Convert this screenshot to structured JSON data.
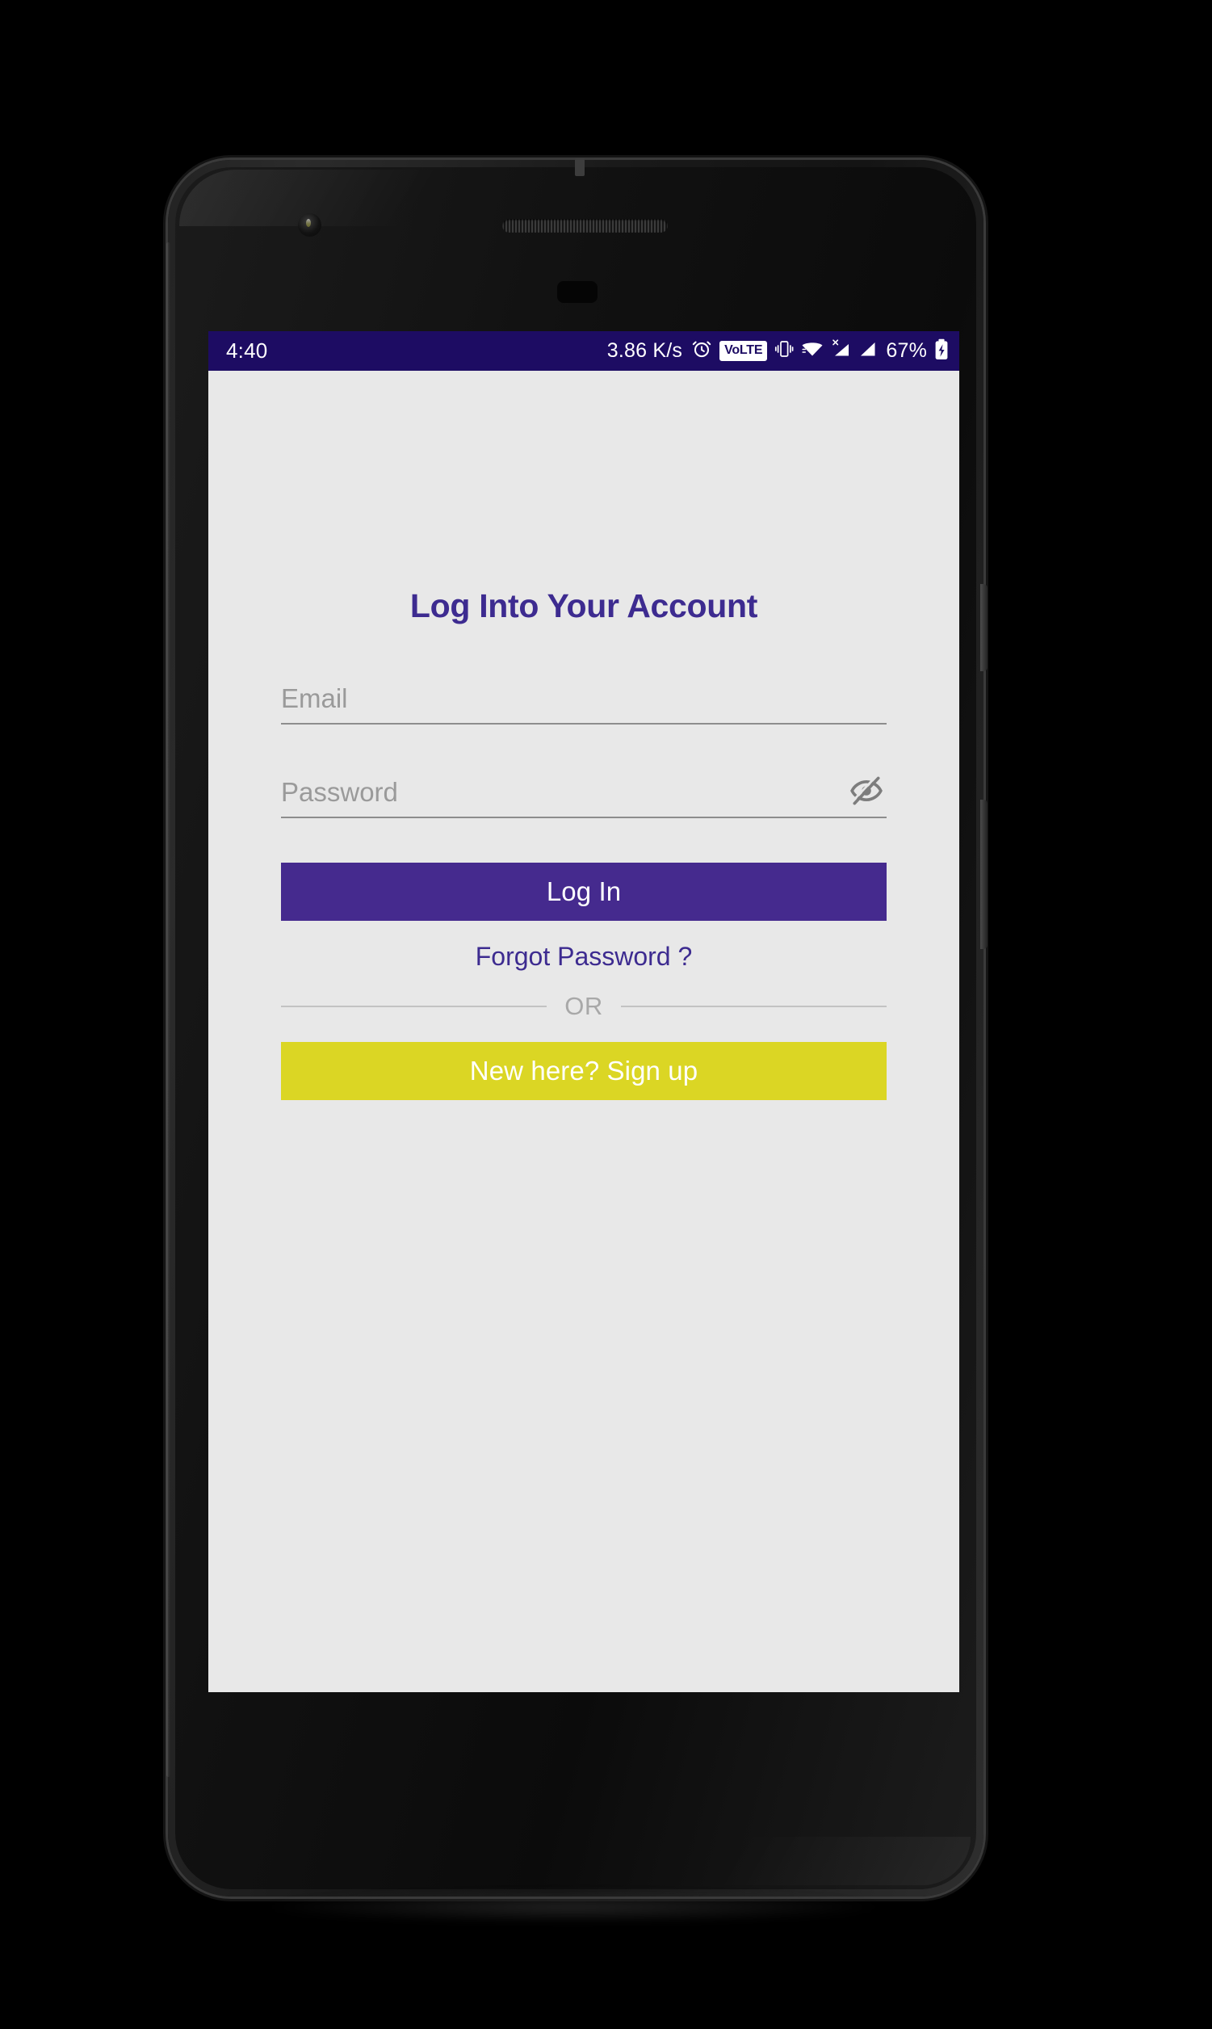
{
  "device": {
    "frame_color": "#1a1a1a",
    "screen_bg": "#e8e8e8",
    "camera_icon": "front-camera-icon",
    "earpiece_icon": "earpiece-speaker-icon",
    "sensor_icon": "proximity-sensor-icon",
    "power_button_label": "Power",
    "volume_button_label": "Volume"
  },
  "status_bar": {
    "background": "#1d0c63",
    "foreground": "#ffffff",
    "clock": "4:40",
    "network_speed": "3.86 K/s",
    "battery_percent": "67%",
    "icons": [
      "alarm-clock-icon",
      "volte-icon",
      "vibrate-icon",
      "wifi-icon",
      "mobile-signal-x-icon",
      "mobile-signal-icon",
      "battery-charging-icon"
    ],
    "volte_label": "VoLTE"
  },
  "screen": {
    "title": "Log Into Your Account",
    "title_color": "#3d2b90",
    "email": {
      "placeholder": "Email",
      "value": ""
    },
    "password": {
      "placeholder": "Password",
      "value": "",
      "toggle_icon": "eye-off-icon",
      "visible": false
    },
    "login_button": {
      "label": "Log In",
      "background": "#452a8e",
      "text_color": "#ffffff"
    },
    "forgot_password": {
      "label": "Forgot Password ?",
      "color": "#3d2b90"
    },
    "divider": {
      "label": "OR",
      "color": "#a8a8a8"
    },
    "signup_button": {
      "label": "New here? Sign up",
      "background": "#dbd624",
      "text_color": "#ffffff"
    }
  }
}
